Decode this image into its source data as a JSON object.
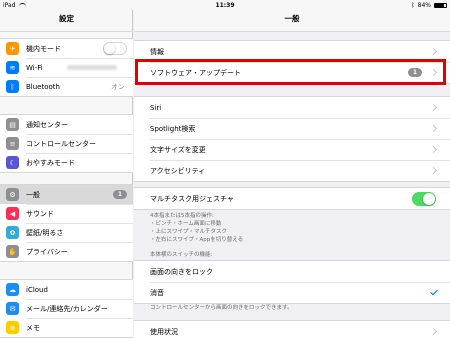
{
  "status_bar": {
    "device": "iPad",
    "time": "11:39",
    "battery": "84%"
  },
  "sidebar": {
    "title": "設定",
    "groups": [
      [
        {
          "label": "機内モード",
          "icon": "airplane-icon",
          "color": "#ff9500",
          "glyph": "✈",
          "accessory": "toggle"
        },
        {
          "label": "Wi-Fi",
          "icon": "wifi-icon",
          "color": "#007aff",
          "glyph": "≋",
          "accessory": "blurred"
        },
        {
          "label": "Bluetooth",
          "icon": "bluetooth-icon",
          "color": "#007aff",
          "glyph": "ᛒ",
          "value": "オン"
        }
      ],
      [
        {
          "label": "通知センター",
          "icon": "notification-center-icon",
          "color": "#8e8e93",
          "glyph": "▤"
        },
        {
          "label": "コントロールセンター",
          "icon": "control-center-icon",
          "color": "#8e8e93",
          "glyph": "≡"
        },
        {
          "label": "おやすみモード",
          "icon": "moon-icon",
          "color": "#5856d6",
          "glyph": "☾"
        }
      ],
      [
        {
          "label": "一般",
          "icon": "gear-icon",
          "color": "#8e8e93",
          "glyph": "⚙",
          "badge": "1",
          "selected": true
        },
        {
          "label": "サウンド",
          "icon": "speaker-icon",
          "color": "#ff2d55",
          "glyph": "◀"
        },
        {
          "label": "壁紙/明るさ",
          "icon": "wallpaper-icon",
          "color": "#34aadc",
          "glyph": "✿"
        },
        {
          "label": "プライバシー",
          "icon": "hand-icon",
          "color": "#8e8e93",
          "glyph": "✋"
        }
      ],
      [
        {
          "label": "iCloud",
          "icon": "cloud-icon",
          "color": "#1e8cf0",
          "glyph": "☁"
        },
        {
          "label": "メール/連絡先/カレンダー",
          "icon": "mail-icon",
          "color": "#1e8cf0",
          "glyph": "✉"
        },
        {
          "label": "メモ",
          "icon": "notes-icon",
          "color": "#ffcc00",
          "glyph": "≡"
        }
      ]
    ]
  },
  "main": {
    "title": "一般",
    "groups": [
      [
        {
          "label": "情報",
          "accessory": "chevron"
        },
        {
          "label": "ソフトウェア・アップデート",
          "accessory": "chevron",
          "badge": "1"
        }
      ],
      [
        {
          "label": "Siri",
          "accessory": "chevron"
        },
        {
          "label": "Spotlight検索",
          "accessory": "chevron"
        },
        {
          "label": "文字サイズを変更",
          "accessory": "chevron"
        },
        {
          "label": "アクセシビリティ",
          "accessory": "chevron"
        }
      ],
      [
        {
          "label": "マルチタスク用ジェスチャ",
          "accessory": "toggle_on"
        }
      ],
      [
        {
          "label": "画面の向きをロック"
        },
        {
          "label": "消音",
          "accessory": "check"
        }
      ],
      [
        {
          "label": "使用状況",
          "accessory": "chevron"
        }
      ]
    ],
    "multitask_note": [
      "4本指または5本指の操作:",
      "・ピンチ・ホーム画面に移動",
      "・上にスワイプ・マルチタスク",
      "・左右にスワイプ・Appを切り替える"
    ],
    "switch_header": "本体横のスイッチの機能:",
    "switch_footer": "コントロールセンターから画面の向きをロックできます。"
  },
  "colors": {
    "highlight": "#e00000",
    "toggle_on": "#4cd964",
    "check": "#007aff"
  }
}
